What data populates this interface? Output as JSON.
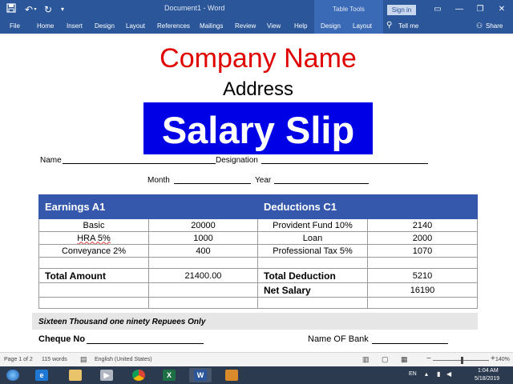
{
  "titlebar": {
    "doc_title": "Document1 - Word",
    "table_tools": "Table Tools",
    "sign_in": "Sign in"
  },
  "ribbon": {
    "tabs": [
      "File",
      "Home",
      "Insert",
      "Design",
      "Layout",
      "References",
      "Mailings",
      "Review",
      "View",
      "Help"
    ],
    "table_tabs": [
      "Design",
      "Layout"
    ],
    "tell_me": "Tell me",
    "share": "Share"
  },
  "document": {
    "company": "Company Name",
    "address": "Address",
    "slip_title": "Salary Slip",
    "name_label": "Name",
    "designation_label": "Designation",
    "month_label": "Month",
    "year_label": "Year",
    "table": {
      "earnings_header": "Earnings A1",
      "deductions_header": "Deductions C1",
      "rows": [
        {
          "earning": "Basic",
          "earning_amt": "20000",
          "deduction": "Provident Fund 10%",
          "deduction_amt": "2140"
        },
        {
          "earning": "HRA 5%",
          "earning_amt": "1000",
          "deduction": "Loan",
          "deduction_amt": "2000"
        },
        {
          "earning": "Conveyance 2%",
          "earning_amt": "400",
          "deduction": "Professional Tax 5%",
          "deduction_amt": "1070"
        }
      ],
      "total_amount_label": "Total Amount",
      "total_amount": "21400.00",
      "total_deduction_label": "Total Deduction",
      "total_deduction": "5210",
      "net_salary_label": "Net Salary",
      "net_salary": "16190"
    },
    "amount_in_words": "Sixteen Thousand one ninety Repuees Only",
    "cheque_label": "Cheque No",
    "bank_label": "Name OF Bank"
  },
  "statusbar": {
    "page": "Page 1 of 2",
    "words": "115 words",
    "language": "English (United States)",
    "zoom": "140%",
    "zoom_fraction": 0.5
  },
  "taskbar": {
    "lang": "EN",
    "time": "1:04 AM",
    "date": "5/18/2019"
  },
  "colors": {
    "word_blue": "#2b579a",
    "company_red": "#e00000",
    "slip_blue": "#0000e6",
    "table_header": "#3558ad"
  }
}
